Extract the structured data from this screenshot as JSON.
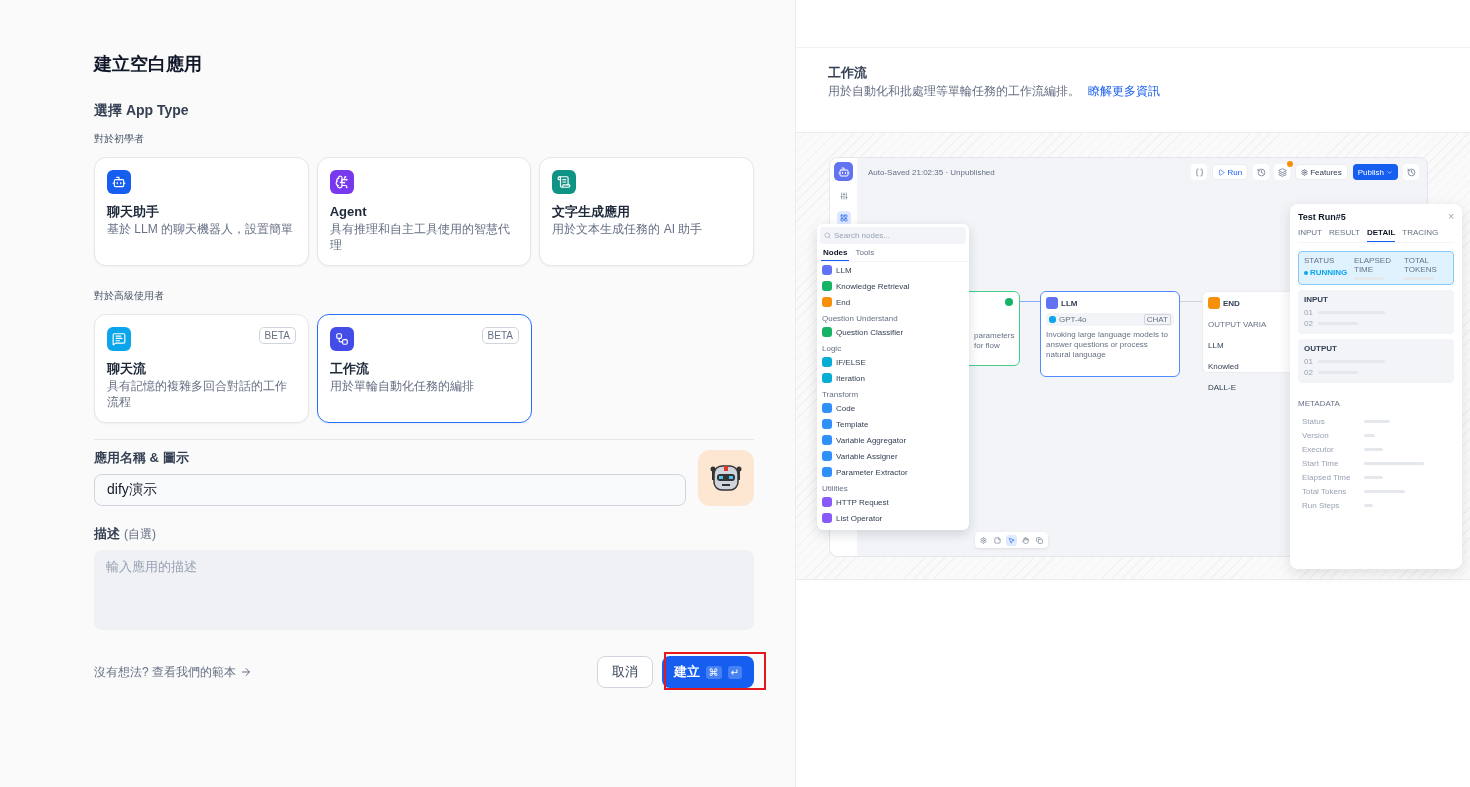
{
  "title": "建立空白應用",
  "type_heading": "選擇 App Type",
  "groups": [
    {
      "label": "對於初學者",
      "cards": [
        {
          "kind": "chatbot",
          "color": "#155eef",
          "title": "聊天助手",
          "description": "基於 LLM 的聊天機器人，設置簡單",
          "selected": false
        },
        {
          "kind": "agent",
          "color": "#7839ee",
          "title": "Agent",
          "description": "具有推理和自主工具使用的智慧代理",
          "selected": false
        },
        {
          "kind": "completion",
          "color": "#0e9384",
          "title": "文字生成應用",
          "description": "用於文本生成任務的 AI 助手",
          "selected": false
        }
      ]
    },
    {
      "label": "對於高級使用者",
      "cards": [
        {
          "kind": "chatflow",
          "color": "#0ba5ec",
          "title": "聊天流",
          "description": "具有記憶的複雜多回合對話的工作流程",
          "badge": "BETA",
          "selected": false
        },
        {
          "kind": "workflow",
          "color": "#444ce7",
          "title": "工作流",
          "description": "用於單輪自動化任務的編排",
          "badge": "BETA",
          "selected": true
        }
      ]
    }
  ],
  "name_field": {
    "label": "應用名稱 & 圖示",
    "value": "dify演示"
  },
  "description_field": {
    "label": "描述",
    "hint": "(自選)",
    "placeholder": "輸入應用的描述"
  },
  "template_link": "沒有想法? 查看我們的範本",
  "buttons": {
    "cancel": "取消",
    "create": "建立",
    "keys": [
      "⌘",
      "↵"
    ]
  },
  "highlight": {
    "on": true
  },
  "preview": {
    "title": "工作流",
    "description": "用於自動化和批處理等單輪任務的工作流編排。",
    "link": "瞭解更多資訊",
    "app": {
      "saved": "Auto-Saved 21:02:35 · Unpublished",
      "run": "Run",
      "features": "Features",
      "publish": "Publish",
      "node_menu": {
        "placeholder": "Search nodes...",
        "tabs": [
          {
            "label": "Nodes",
            "selected": true
          },
          {
            "label": "Tools",
            "selected": false
          }
        ],
        "groups": [
          {
            "items": [
              {
                "label": "LLM",
                "color": "#6172f3"
              },
              {
                "label": "Knowledge Retrieval",
                "color": "#16b364"
              },
              {
                "label": "End",
                "color": "#f79009"
              }
            ]
          },
          {
            "label": "Question Understand",
            "items": [
              {
                "label": "Question Classifier",
                "color": "#16b364"
              }
            ]
          },
          {
            "label": "Logic",
            "items": [
              {
                "label": "IF/ELSE",
                "color": "#06aed4"
              },
              {
                "label": "Iteration",
                "color": "#06aed4"
              }
            ]
          },
          {
            "label": "Transform",
            "items": [
              {
                "label": "Code",
                "color": "#2e90fa"
              },
              {
                "label": "Template",
                "color": "#2e90fa"
              },
              {
                "label": "Variable Aggregator",
                "color": "#2e90fa"
              },
              {
                "label": "Variable Assigner",
                "color": "#2e90fa"
              },
              {
                "label": "Parameter Extractor",
                "color": "#2e90fa"
              }
            ]
          },
          {
            "label": "Utilities",
            "items": [
              {
                "label": "HTTP Request",
                "color": "#875bf7"
              },
              {
                "label": "List Operator",
                "color": "#875bf7"
              }
            ]
          }
        ]
      },
      "start_node": {
        "description": "parameters for flow"
      },
      "llm_node": {
        "title": "LLM",
        "model": "GPT-4o",
        "mode": "CHAT",
        "description": "Invoking large language models to answer questions or process natural language"
      },
      "end_node": {
        "title": "END",
        "output_label": "OUTPUT VARIA",
        "outputs": [
          "LLM",
          "Knowled",
          "DALL-E"
        ]
      },
      "test_run": {
        "title": "Test Run#5",
        "close": "×",
        "tabs": [
          {
            "label": "INPUT",
            "selected": false
          },
          {
            "label": "RESULT",
            "selected": false
          },
          {
            "label": "DETAIL",
            "selected": true
          },
          {
            "label": "TRACING",
            "selected": false
          }
        ],
        "status": [
          {
            "label": "STATUS",
            "value": "RUNNING"
          },
          {
            "label": "ELAPSED TIME"
          },
          {
            "label": "TOTAL TOKENS"
          }
        ],
        "sections": [
          {
            "title": "INPUT",
            "rows": [
              "01",
              "02"
            ]
          },
          {
            "title": "OUTPUT",
            "rows": [
              "01",
              "02"
            ]
          }
        ],
        "metadata_title": "METADATA",
        "metadata": [
          "Status",
          "Version",
          "Executor",
          "Start Time",
          "Elapsed Time",
          "Total Tokens",
          "Run Steps"
        ]
      }
    }
  }
}
